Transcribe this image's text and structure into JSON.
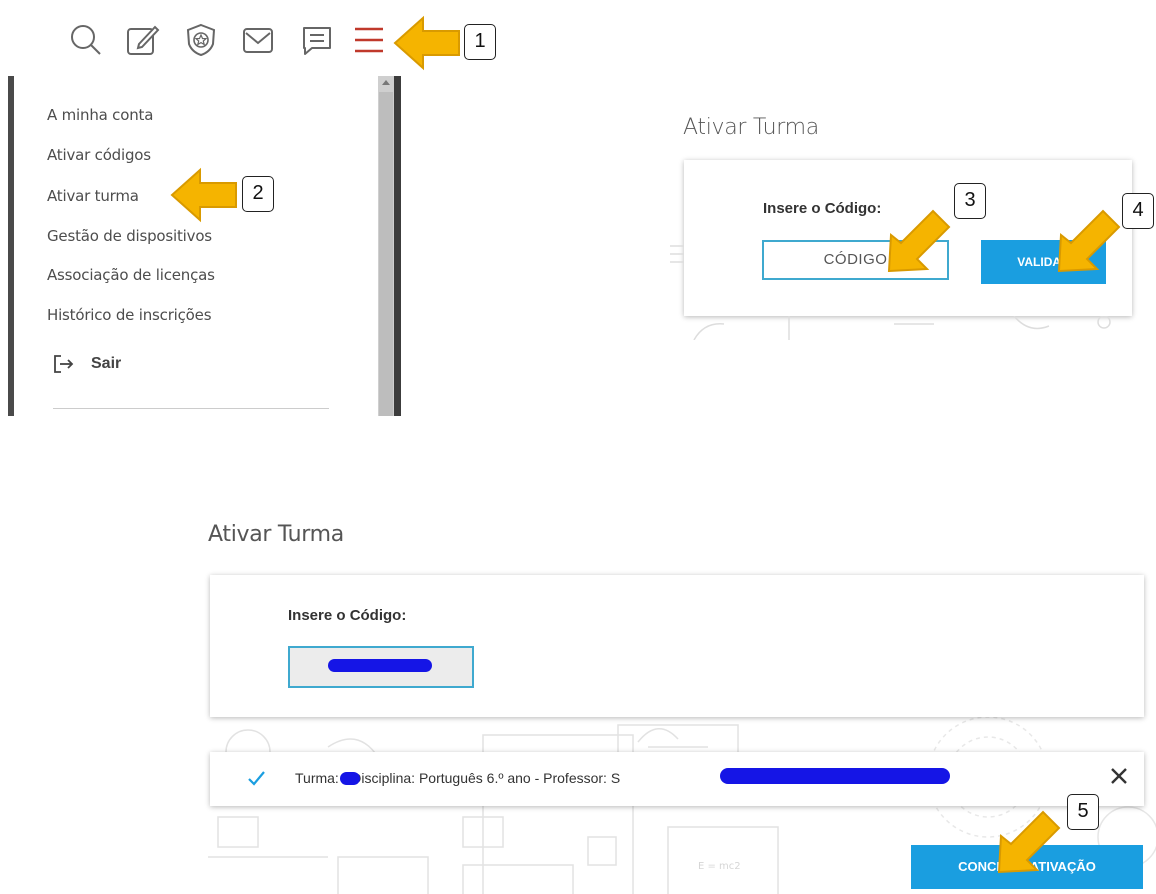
{
  "toolbar": {
    "icons": [
      "search-icon",
      "edit-icon",
      "badge-star-icon",
      "mail-icon",
      "chat-icon",
      "hamburger-menu-icon"
    ],
    "accent_color": "#c0392b"
  },
  "menu": {
    "items": [
      {
        "label": "A minha conta"
      },
      {
        "label": "Ativar códigos"
      },
      {
        "label": "Ativar turma"
      },
      {
        "label": "Gestão de dispositivos"
      },
      {
        "label": "Associação de licenças"
      },
      {
        "label": "Histórico de inscrições"
      }
    ],
    "logout_label": "Sair"
  },
  "callouts": [
    "1",
    "2",
    "3",
    "4",
    "5"
  ],
  "activate_top": {
    "title": "Ativar Turma",
    "code_label": "Insere o Código:",
    "code_placeholder": "CÓDIGO",
    "validate_label": "VALIDAR"
  },
  "activate_bottom": {
    "title": "Ativar Turma",
    "code_label": "Insere o Código:",
    "notice_text": "Turma:      - Disciplina: Português 6.º ano - Professor: S",
    "complete_label": "CONCLUIR ATIVAÇÃO"
  },
  "colors": {
    "primary_button": "#1a9ee0",
    "input_border": "#3fa9cf",
    "arrow_fill": "#f5b400",
    "redaction": "#1515e6"
  }
}
